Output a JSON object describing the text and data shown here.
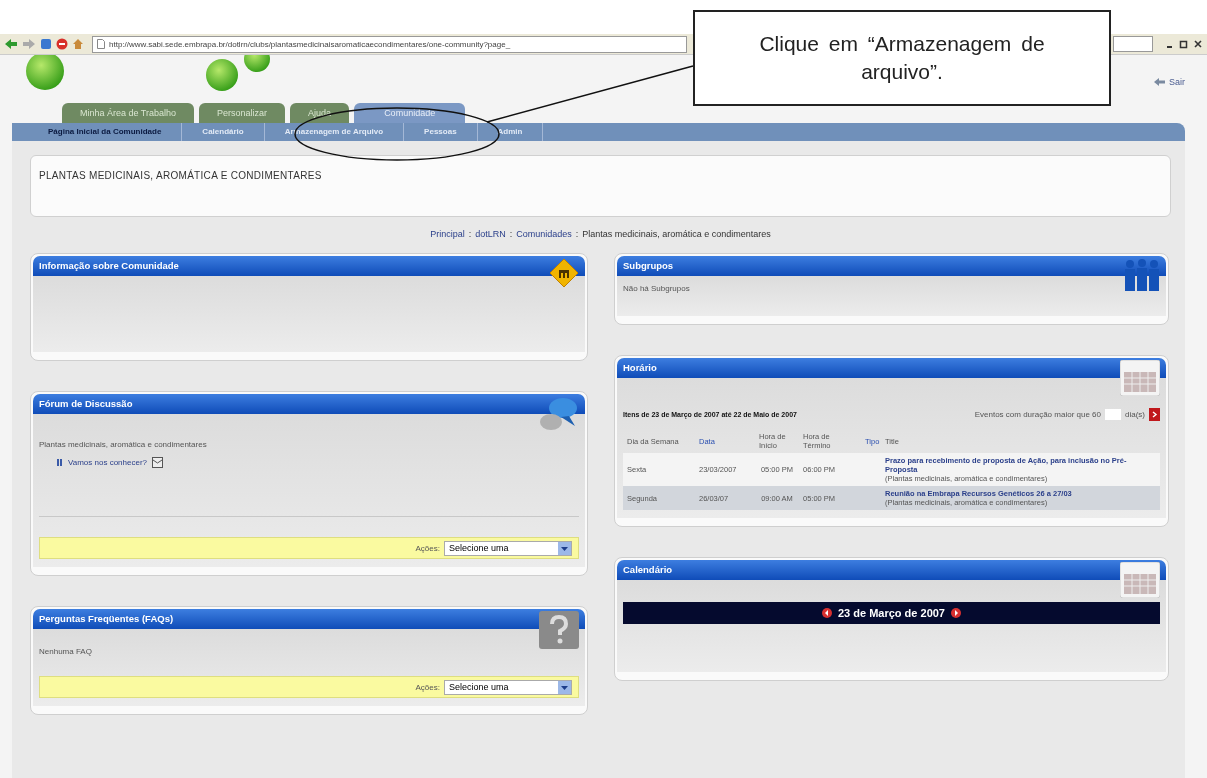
{
  "browser": {
    "url": "http://www.sabi.sede.embrapa.br/dotlrn/clubs/plantasmedicinaisaromaticaecondimentares/one-community?page_",
    "top_link": "Sair"
  },
  "tabs": [
    {
      "label": "Minha Área de Trabalho",
      "selected": false
    },
    {
      "label": "Personalizar",
      "selected": false
    },
    {
      "label": "Ajuda",
      "selected": false
    },
    {
      "label": "Comunidade",
      "selected": true
    }
  ],
  "subnav": [
    {
      "label": "Página Inicial da Comunidade",
      "selected": true
    },
    {
      "label": "Calendário",
      "selected": false
    },
    {
      "label": "Armazenagem de Arquivo",
      "selected": false
    },
    {
      "label": "Pessoas",
      "selected": false
    },
    {
      "label": "Admin",
      "selected": false
    }
  ],
  "community_title": "PLANTAS MEDICINAIS, AROMÁTICA E CONDIMENTARES",
  "breadcrumb": [
    {
      "label": "Principal",
      "link": true
    },
    {
      "sep": ":",
      "label": "dotLRN",
      "link": true
    },
    {
      "sep": ":",
      "label": "Comunidades",
      "link": true
    },
    {
      "sep": ":",
      "label": "Plantas medicinais, aromática e condimentares",
      "link": false
    }
  ],
  "left_column": [
    {
      "kind": "info",
      "title": "Informação sobre Comunidade"
    },
    {
      "kind": "forum",
      "title": "Fórum de Discussão",
      "forum_name": "Plantas medicinais, aromática e condimentares",
      "threads": [
        "Vamos nos conhecer?"
      ],
      "actions": {
        "label": "Ações:",
        "value": "Selecione uma"
      }
    },
    {
      "kind": "faq",
      "title": "Perguntas Freqüentes (FAQs)",
      "message": "Nenhuma FAQ",
      "actions": {
        "label": "Ações:",
        "value": "Selecione uma"
      }
    }
  ],
  "right_column": [
    {
      "kind": "subgroups",
      "title": "Subgrupos",
      "message": "Não há Subgrupos"
    },
    {
      "kind": "schedule",
      "title": "Horário",
      "range": "Itens de 23 de Março de 2007 até 22 de Maio de 2007",
      "filter": {
        "label": "Eventos com duração maior que 60",
        "unit": "dia(s)"
      },
      "columns": [
        {
          "label": "Dia da Semana",
          "link": false
        },
        {
          "label": "Data",
          "link": true
        },
        {
          "label": "Hora de Início",
          "link": false
        },
        {
          "label": "Hora de Término",
          "link": false
        },
        {
          "label": "Tipo",
          "link": true
        },
        {
          "label": "Title",
          "link": false
        }
      ],
      "rows": [
        {
          "day": "Sexta",
          "date": "23/03/2007",
          "start": "05:00 PM",
          "end": "06:00 PM",
          "title": "Prazo para recebimento de proposta de Ação, para inclusão no Pré-Proposta",
          "context": "(Plantas medicinais, aromática e condimentares)",
          "shaded": false
        },
        {
          "day": "Segunda",
          "date": "26/03/07",
          "start": "09:00 AM",
          "end": "05:00 PM",
          "title": "Reunião na Embrapa Recursos Genéticos 26 a 27/03",
          "context": "(Plantas medicinais, aromática e condimentares)",
          "shaded": true
        }
      ]
    },
    {
      "kind": "calendar",
      "title": "Calendário",
      "date": "23 de Março de 2007"
    }
  ],
  "callout": {
    "text": "Clique em “Armazenagem de arquivo”."
  }
}
